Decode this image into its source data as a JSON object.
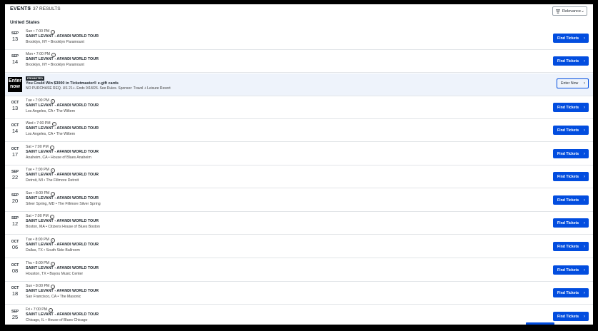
{
  "header": {
    "title": "EVENTS",
    "separator": "•",
    "results": "37 RESULTS",
    "sort_label": "Relevance"
  },
  "region": "United States",
  "promo": {
    "badge": "Enter now",
    "tag": "PROMOTED",
    "headline": "You Could Win $3000 in Ticketmaster® e-gift cards",
    "fine_print": "NO PURCHASE REQ. US 21+. Ends 9/18/26. See Rules. Sponsor: Travel + Leisure Resort",
    "button": "Enter Now"
  },
  "button_label": "Find Tickets",
  "events": [
    {
      "month": "SEP",
      "day": "13",
      "time": "Sun • 7:00 PM",
      "name": "SAINT LEVANT - AFANDI WORLD TOUR",
      "venue": "Brooklyn, NY • Brooklyn Paramount"
    },
    {
      "month": "SEP",
      "day": "14",
      "time": "Mon • 7:00 PM",
      "name": "SAINT LEVANT - AFANDI WORLD TOUR",
      "venue": "Brooklyn, NY • Brooklyn Paramount"
    },
    {
      "month": "OCT",
      "day": "13",
      "time": "Tue • 7:00 PM",
      "name": "SAINT LEVANT - AFANDI WORLD TOUR",
      "venue": "Los Angeles, CA • The Wiltern"
    },
    {
      "month": "OCT",
      "day": "14",
      "time": "Wed • 7:00 PM",
      "name": "SAINT LEVANT - AFANDI WORLD TOUR",
      "venue": "Los Angeles, CA • The Wiltern"
    },
    {
      "month": "OCT",
      "day": "17",
      "time": "Sat • 7:00 PM",
      "name": "SAINT LEVANT - AFANDI WORLD TOUR",
      "venue": "Anaheim, CA • House of Blues Anaheim"
    },
    {
      "month": "SEP",
      "day": "22",
      "time": "Tue • 7:00 PM",
      "name": "SAINT LEVANT - AFANDI WORLD TOUR",
      "venue": "Detroit, MI • The Fillmore Detroit"
    },
    {
      "month": "SEP",
      "day": "20",
      "time": "Sun • 8:00 PM",
      "name": "SAINT LEVANT - AFANDI WORLD TOUR",
      "venue": "Silver Spring, MD • The Fillmore Silver Spring"
    },
    {
      "month": "SEP",
      "day": "12",
      "time": "Sat • 7:00 PM",
      "name": "SAINT LEVANT - AFANDI WORLD TOUR",
      "venue": "Boston, MA • Citizens House of Blues Boston"
    },
    {
      "month": "OCT",
      "day": "06",
      "time": "Tue • 8:00 PM",
      "name": "SAINT LEVANT - AFANDI WORLD TOUR",
      "venue": "Dallas, TX • South Side Ballroom"
    },
    {
      "month": "OCT",
      "day": "08",
      "time": "Thu • 8:00 PM",
      "name": "SAINT LEVANT - AFANDI WORLD TOUR",
      "venue": "Houston, TX • Bayou Music Center"
    },
    {
      "month": "OCT",
      "day": "18",
      "time": "Sun • 8:00 PM",
      "name": "SAINT LEVANT - AFANDI WORLD TOUR",
      "venue": "San Francisco, CA • The Masonic"
    },
    {
      "month": "SEP",
      "day": "25",
      "time": "Fri • 7:00 PM",
      "name": "SAINT LEVANT - AFANDI WORLD TOUR",
      "venue": "Chicago, IL • House of Blues Chicago"
    }
  ],
  "colors": {
    "accent": "#024ddf",
    "promo_bg": "#eef3fb"
  }
}
